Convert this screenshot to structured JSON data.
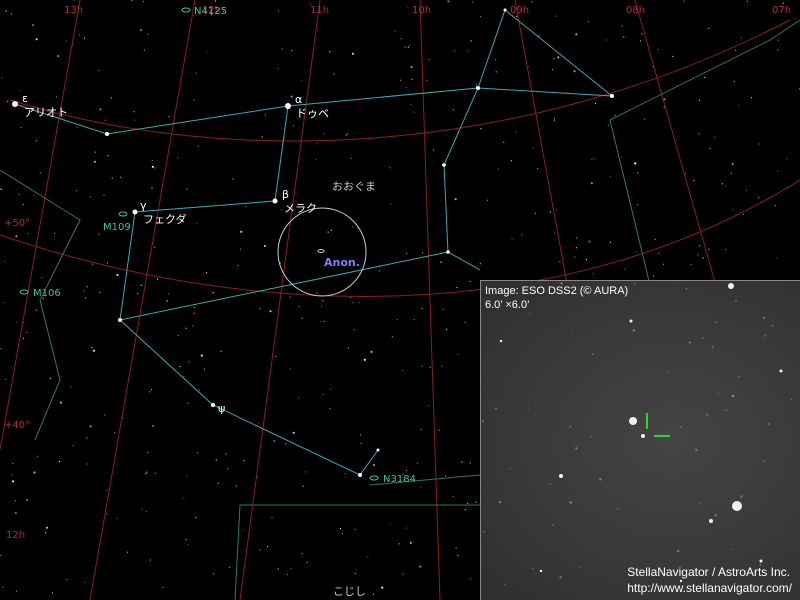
{
  "ra_labels": [
    "13h",
    "12h",
    "11h",
    "10h",
    "09h",
    "08h",
    "07h"
  ],
  "dec_labels": [
    "+50°",
    "+40°"
  ],
  "bottom_ra_label": "12h",
  "constellations": {
    "uma": "おおぐま",
    "lmi": "こじし"
  },
  "stars": {
    "alioth": {
      "greek": "ε",
      "name": "アリオト"
    },
    "dubhe": {
      "greek": "α",
      "name": "ドゥベ"
    },
    "merak": {
      "greek": "β",
      "name": "メラク"
    },
    "phecda": {
      "greek": "γ",
      "name": "フェクダ"
    },
    "psi": {
      "greek": "ψ"
    }
  },
  "galaxies": {
    "n4125": "N4125",
    "m109": "M109",
    "m106": "M106",
    "n3184": "N3184"
  },
  "target": "Anon.",
  "inset": {
    "header_line1": "Image: ESO DSS2 (© AURA)",
    "header_line2": "6.0’ ×6.0’",
    "credit_line1": "StellaNavigator / AstroArts Inc.",
    "credit_line2": "http://www.stellanavigator.com/"
  },
  "colors": {
    "ra_dec_grid": "#8b1e1e",
    "constellation_line": "#3fa6b8",
    "boundary": "#2e7d4a",
    "label_grid": "#b03030",
    "galaxy": "#40c0a0",
    "target": "#8080ff",
    "marker": "#22dd22"
  }
}
